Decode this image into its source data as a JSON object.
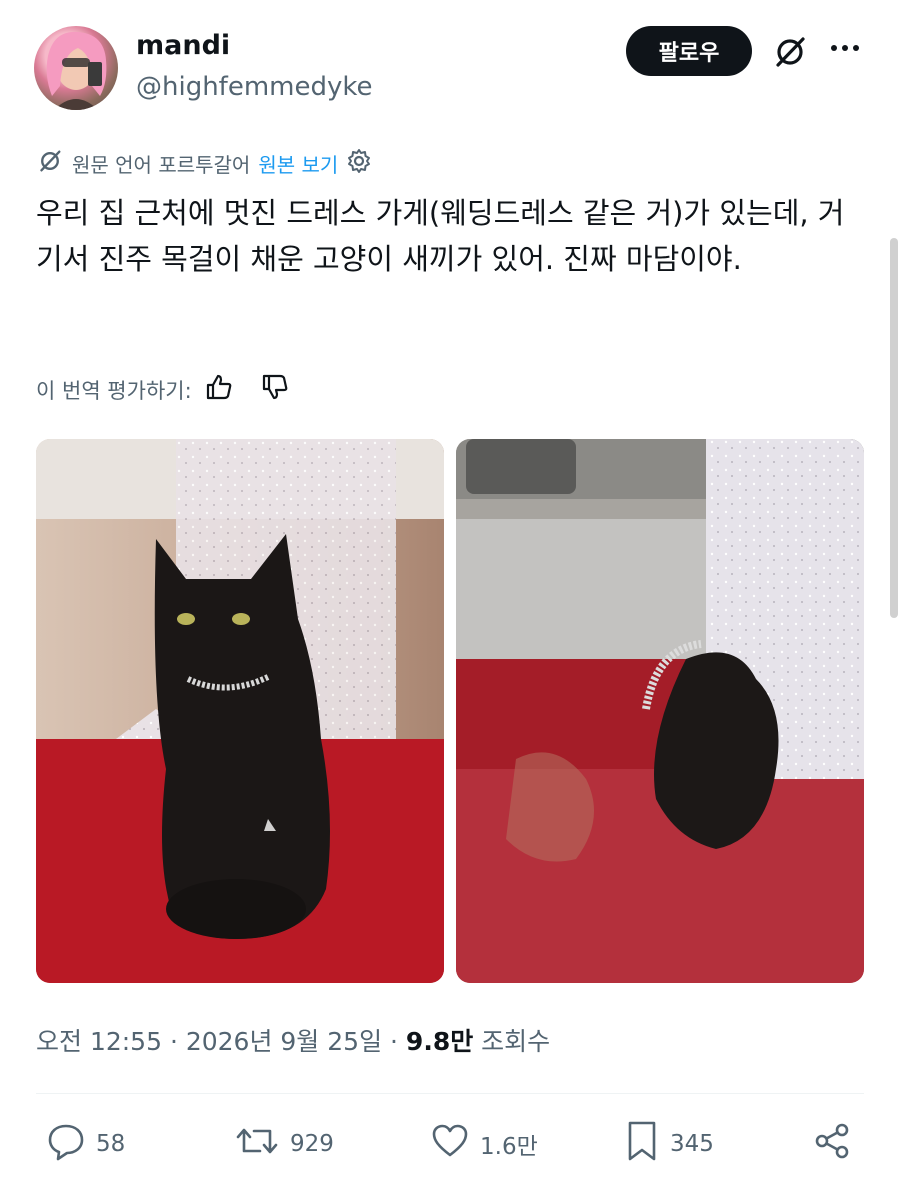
{
  "author": {
    "display_name": "mandi",
    "handle": "@highfemmedyke",
    "follow_label": "팔로우"
  },
  "translation": {
    "source_label": "원문 언어 포르투갈어",
    "view_original_label": "원본 보기",
    "rate_label": "이 번역 평가하기:"
  },
  "tweet": {
    "text": "우리 집 근처에 멋진 드레스 가게(웨딩드레스 같은 거)가 있는데, 거기서 진주 목걸이 채운 고양이 새끼가 있어. 진짜 마담이야."
  },
  "meta": {
    "time": "오전 12:55 · 2026년 9월 25일 · ",
    "views_count": "9.8만",
    "views_label": " 조회수"
  },
  "actions": {
    "replies": "58",
    "reposts": "929",
    "likes": "1.6만",
    "bookmarks": "345"
  },
  "icons": {
    "grok": "grok-icon",
    "more": "more-icon",
    "settings": "gear-icon",
    "reply": "reply-icon",
    "repost": "repost-icon",
    "like": "heart-icon",
    "bookmark": "bookmark-icon",
    "share": "share-icon"
  },
  "colors": {
    "link": "#1d9bf0",
    "secondary_text": "#536471",
    "follow_button": "#0f1419"
  }
}
